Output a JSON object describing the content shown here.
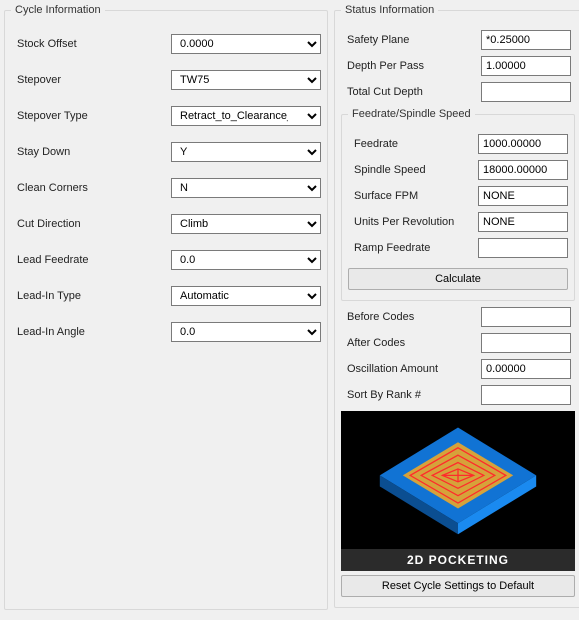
{
  "cycle": {
    "legend": "Cycle Information",
    "stock_offset": {
      "label": "Stock Offset",
      "value": "0.0000"
    },
    "stepover": {
      "label": "Stepover",
      "value": "TW75"
    },
    "stepover_type": {
      "label": "Stepover Type",
      "value": "Retract_to_Clearance_Area"
    },
    "stay_down": {
      "label": "Stay Down",
      "value": "Y"
    },
    "clean_corners": {
      "label": "Clean Corners",
      "value": "N"
    },
    "cut_direction": {
      "label": "Cut Direction",
      "value": "Climb"
    },
    "lead_feedrate": {
      "label": "Lead Feedrate",
      "value": "0.0"
    },
    "lead_in_type": {
      "label": "Lead-In Type",
      "value": "Automatic"
    },
    "lead_in_angle": {
      "label": "Lead-In Angle",
      "value": "0.0"
    }
  },
  "status": {
    "legend": "Status Information",
    "safety_plane": {
      "label": "Safety Plane",
      "value": "*0.25000"
    },
    "depth_per_pass": {
      "label": "Depth Per Pass",
      "value": "1.00000"
    },
    "total_cut_depth": {
      "label": "Total Cut Depth",
      "value": ""
    },
    "feedrate_group": {
      "legend": "Feedrate/Spindle Speed",
      "feedrate": {
        "label": "Feedrate",
        "value": "1000.00000"
      },
      "spindle_speed": {
        "label": "Spindle Speed",
        "value": "18000.00000"
      },
      "surface_fpm": {
        "label": "Surface FPM",
        "value": "NONE"
      },
      "units_per_rev": {
        "label": "Units Per Revolution",
        "value": "NONE"
      },
      "ramp_feedrate": {
        "label": "Ramp Feedrate",
        "value": ""
      },
      "calculate_btn": "Calculate"
    },
    "before_codes": {
      "label": "Before Codes",
      "value": ""
    },
    "after_codes": {
      "label": "After Codes",
      "value": ""
    },
    "oscillation_amount": {
      "label": "Oscillation Amount",
      "value": "0.00000"
    },
    "sort_by_rank": {
      "label": "Sort By Rank #",
      "value": ""
    },
    "preview_caption": "2D POCKETING",
    "reset_btn": "Reset Cycle Settings to Default"
  }
}
